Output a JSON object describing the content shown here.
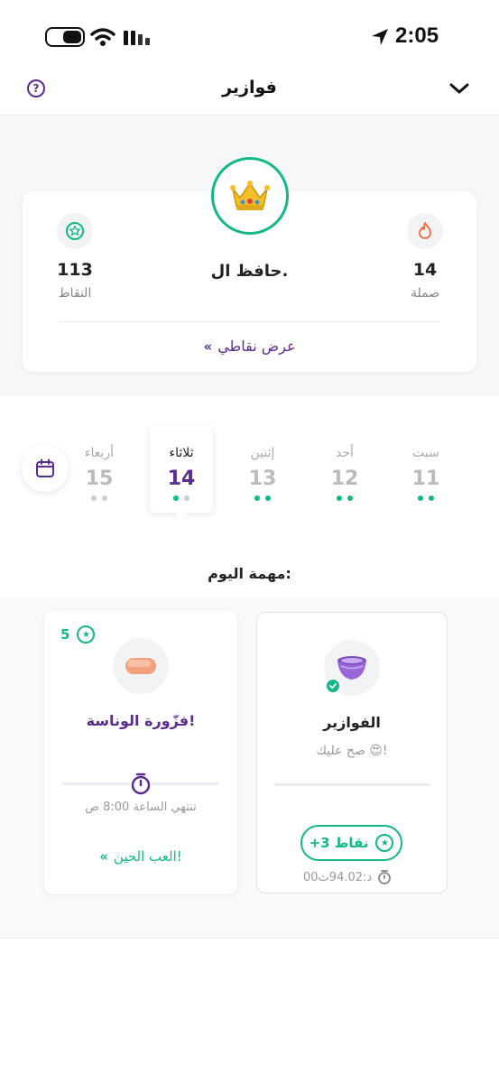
{
  "status_bar": {
    "time": "2:05"
  },
  "header": {
    "title": "فوازير"
  },
  "profile": {
    "name": "حافظ ال.",
    "points_value": "113",
    "points_label": "النقاط",
    "streak_value": "14",
    "streak_label": "صملة",
    "view_points": "عرض نقاطي",
    "view_points_arrows": "«"
  },
  "days": [
    {
      "name": "أربعاء",
      "num": "15",
      "active": false,
      "done": false
    },
    {
      "name": "ثلاثاء",
      "num": "14",
      "active": true,
      "done": true
    },
    {
      "name": "إثنين",
      "num": "13",
      "active": false,
      "done": true
    },
    {
      "name": "أحد",
      "num": "12",
      "active": false,
      "done": true
    },
    {
      "name": "سبت",
      "num": "11",
      "active": false,
      "done": true
    }
  ],
  "task_section_title": "مهمة اليوم:",
  "tasks": {
    "left": {
      "points": "5",
      "title": "فزّورة الوناسة!",
      "ends_text": "تنتهي  الساعة 8:00 ص",
      "play_label": "العب الحين!",
      "play_arrows": "«"
    },
    "right": {
      "title": "الفوازير",
      "subtitle": "صح عليك 😍!",
      "reward": "+3 نقاط",
      "timer": "00د:94.02ث"
    }
  },
  "colors": {
    "brand": "#5b2d90",
    "accent": "#12b886",
    "streak": "#f06a3c"
  }
}
